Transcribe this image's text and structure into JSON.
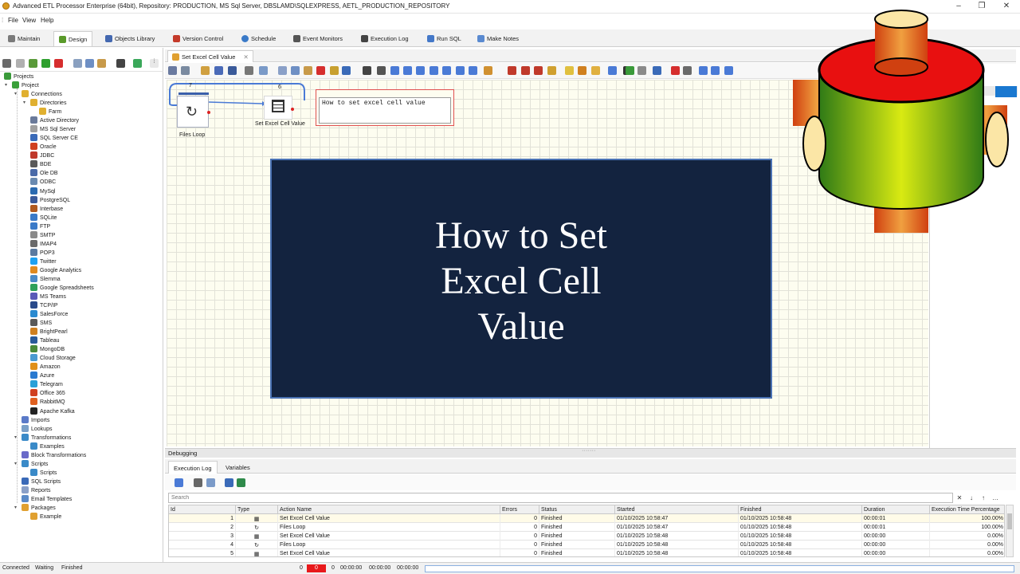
{
  "window": {
    "title": "Advanced ETL Processor Enterprise (64bit), Repository: PRODUCTION, MS Sql Server, DBSLAMD\\SQLEXPRESS, AETL_PRODUCTION_REPOSITORY",
    "controls": [
      "–",
      "❐",
      "✕"
    ]
  },
  "menu": [
    "File",
    "View",
    "Help"
  ],
  "main_tabs": [
    {
      "label": "Maintain",
      "icon": "wrench-icon",
      "color": "#7a7a7a"
    },
    {
      "label": "Design",
      "icon": "design-icon",
      "color": "#5a9a2a"
    },
    {
      "label": "Objects Library",
      "icon": "library-icon",
      "color": "#4468b0"
    },
    {
      "label": "Version Control",
      "icon": "version-icon",
      "color": "#c43a2a"
    },
    {
      "label": "Schedule",
      "icon": "clock-icon",
      "color": "#3a7ac8"
    },
    {
      "label": "Event Monitors",
      "icon": "monitor-icon",
      "color": "#555555"
    },
    {
      "label": "Execution Log",
      "icon": "binoculars-icon",
      "color": "#444444"
    },
    {
      "label": "Run SQL",
      "icon": "sql-icon",
      "color": "#4478c8"
    },
    {
      "label": "Make Notes",
      "icon": "notes-icon",
      "color": "#5a8ad0"
    }
  ],
  "tree": {
    "root": "Projects",
    "project": "Project",
    "connections": "Connections",
    "directories": "Directories",
    "farm": "Farm",
    "connection_items": [
      "Active Directory",
      "MS Sql Server",
      "SQL Server CE",
      "Oracle",
      "JDBC",
      "BDE",
      "Ole DB",
      "ODBC",
      "MySql",
      "PostgreSQL",
      "Interbase",
      "SQLite",
      "FTP",
      "SMTP",
      "IMAP4",
      "POP3",
      "Twitter",
      "Google Analytics",
      "Slemma",
      "Google Spreadsheets",
      "MS Teams",
      "TCP/IP",
      "SalesForce",
      "SMS",
      "BrightPearl",
      "Tableau",
      "MongoDB",
      "Cloud Storage",
      "Amazon",
      "Azure",
      "Telegram",
      "Office 365",
      "RabbitMQ",
      "Apache Kafka"
    ],
    "imports": "Imports",
    "lookups": "Lookups",
    "transformations": "Transformations",
    "transformations_examples": "Examples",
    "block_transformations": "Block Transformations",
    "scripts": "Scripts",
    "scripts_child": "Scripts",
    "sql_scripts": "SQL Scripts",
    "reports": "Reports",
    "email_templates": "Email Templates",
    "packages": "Packages",
    "packages_example": "Example"
  },
  "doc_tab": {
    "label": "Set Excel Cell Value"
  },
  "canvas": {
    "files_loop": {
      "label": "Files Loop",
      "badge": "7"
    },
    "set_excel": {
      "label": "Set Excel Cell Value",
      "badge": "6"
    },
    "note_text": "How to set excel cell value"
  },
  "overlay": {
    "line1": "How to Set",
    "line2": "Excel Cell",
    "line3": "Value"
  },
  "debugging": {
    "title": "Debugging",
    "tabs": [
      "Execution Log",
      "Variables"
    ],
    "search_placeholder": "Search",
    "search_buttons": [
      "✕",
      "↓",
      "↑",
      "…"
    ],
    "columns": [
      "Id",
      "Type",
      "Action Name",
      "Errors",
      "Status",
      "Started",
      "Finished",
      "Duration",
      "Execution Time Percentage"
    ],
    "rows": [
      {
        "id": "1",
        "action": "Set Excel Cell Value",
        "errors": "0",
        "status": "Finished",
        "started": "01/10/2025 10:58:47",
        "finished": "01/10/2025 10:58:48",
        "duration": "00:00:01",
        "pct": "100.00%"
      },
      {
        "id": "2",
        "action": "Files Loop",
        "errors": "0",
        "status": "Finished",
        "started": "01/10/2025 10:58:47",
        "finished": "01/10/2025 10:58:48",
        "duration": "00:00:01",
        "pct": "100.00%"
      },
      {
        "id": "3",
        "action": "Set Excel Cell Value",
        "errors": "0",
        "status": "Finished",
        "started": "01/10/2025 10:58:48",
        "finished": "01/10/2025 10:58:48",
        "duration": "00:00:00",
        "pct": "0.00%"
      },
      {
        "id": "4",
        "action": "Files Loop",
        "errors": "0",
        "status": "Finished",
        "started": "01/10/2025 10:58:48",
        "finished": "01/10/2025 10:58:48",
        "duration": "00:00:00",
        "pct": "0.00%"
      },
      {
        "id": "5",
        "action": "Set Excel Cell Value",
        "errors": "0",
        "status": "Finished",
        "started": "01/10/2025 10:58:48",
        "finished": "01/10/2025 10:58:48",
        "duration": "00:00:00",
        "pct": "0.00%"
      }
    ]
  },
  "status": {
    "connected": "Connected",
    "waiting": "Waiting",
    "finished": "Finished",
    "count_a": "0",
    "count_b": "0",
    "count_c": "0",
    "time1": "00:00:00",
    "time2": "00:00:00",
    "time3": "00:00:00",
    "error_color": "#e8191b"
  }
}
